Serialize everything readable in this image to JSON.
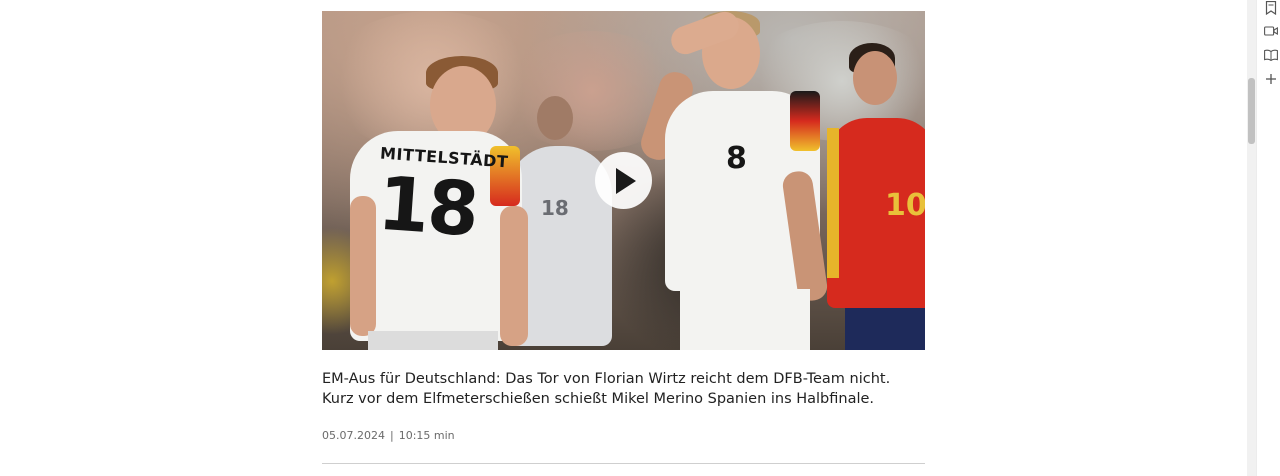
{
  "video": {
    "alt_jersey_name": "MITTELSTÄDT",
    "alt_jersey_number_left": "18",
    "alt_jersey_number_center": "8",
    "alt_jersey_number_right": "10",
    "alt_jersey_number_back": "18"
  },
  "article": {
    "caption": "EM-Aus für Deutschland: Das Tor von Florian Wirtz reicht dem DFB-Team nicht. Kurz vor dem Elfmeterschießen schießt Mikel Merino Spanien ins Halbfinale.",
    "date": "05.07.2024",
    "separator": "|",
    "duration": "10:15 min"
  },
  "sidebar_icons": [
    "bookmark-icon",
    "video-icon",
    "reading-mode-icon",
    "plus-icon"
  ],
  "colors": {
    "background": "#ffffff",
    "text": "#222222",
    "meta": "#6b6b6b",
    "spain_red": "#d62a1e"
  }
}
